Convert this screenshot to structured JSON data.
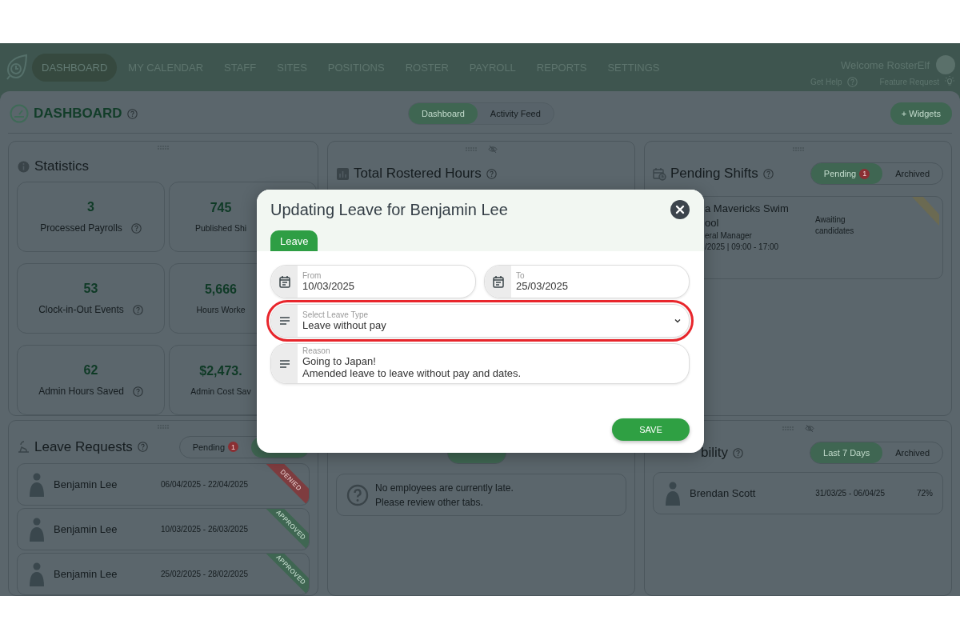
{
  "nav": {
    "items": [
      {
        "label": "DASHBOARD",
        "selected": true
      },
      {
        "label": "MY CALENDAR",
        "selected": false
      },
      {
        "label": "STAFF",
        "selected": false
      },
      {
        "label": "SITES",
        "selected": false
      },
      {
        "label": "POSITIONS",
        "selected": false
      },
      {
        "label": "ROSTER",
        "selected": false
      },
      {
        "label": "PAYROLL",
        "selected": false
      },
      {
        "label": "REPORTS",
        "selected": false
      },
      {
        "label": "SETTINGS",
        "selected": false
      }
    ],
    "welcome": "Welcome RosterElf",
    "help": "Get Help",
    "feature": "Feature Request"
  },
  "header": {
    "title": "DASHBOARD",
    "views": [
      {
        "label": "Dashboard",
        "selected": true
      },
      {
        "label": "Activity Feed",
        "selected": false
      }
    ],
    "add_button": "+ Widgets"
  },
  "statistics": {
    "title": "Statistics",
    "items": [
      {
        "value": "3",
        "label": "Processed Payrolls"
      },
      {
        "value": "745",
        "label": "Published Shi"
      },
      {
        "value": "53",
        "label": "Clock-in-Out Events"
      },
      {
        "value": "5,666",
        "label": "Hours Worke"
      },
      {
        "value": "62",
        "label": "Admin Hours Saved"
      },
      {
        "value": "$2,473.",
        "label": "Admin Cost Sav"
      }
    ]
  },
  "rostered_hours": {
    "title": "Total Rostered Hours"
  },
  "pending_shifts": {
    "title": "Pending Shifts",
    "tabs": [
      {
        "label": "Pending",
        "badge": "1",
        "selected": true
      },
      {
        "label": "Archived",
        "selected": false
      }
    ],
    "shift": {
      "lines": [
        "a Mavericks Swim",
        "ool",
        "eral Manager",
        "/2025 | 09:00 - 17:00"
      ],
      "status": "Awaiting candidates"
    }
  },
  "leave_requests": {
    "title": "Leave Requests",
    "tabs": [
      {
        "label": "Pending",
        "badge": "1",
        "selected": false
      },
      {
        "selected": true
      }
    ],
    "rows": [
      {
        "name": "Benjamin Lee",
        "dates": "06/04/2025 - 22/04/2025",
        "status": "DENIED",
        "kind": "denied"
      },
      {
        "name": "Benjamin Lee",
        "dates": "10/03/2025 - 26/03/2025",
        "status": "APPROVED",
        "kind": "approved"
      },
      {
        "name": "Benjamin Lee",
        "dates": "25/02/2025 - 28/02/2025",
        "status": "APPROVED",
        "kind": "approved"
      }
    ]
  },
  "late": {
    "tabs": [
      {
        "selected": true
      }
    ],
    "message": [
      "No employees are currently late.",
      "Please review other tabs."
    ]
  },
  "availability": {
    "title": "bility",
    "tabs": [
      {
        "label": "Last 7 Days",
        "selected": true
      },
      {
        "label": "Archived",
        "selected": false
      }
    ],
    "rows": [
      {
        "name": "Brendan Scott",
        "dates": "31/03/25 - 06/04/25",
        "percent": "72%"
      }
    ]
  },
  "modal": {
    "title": "Updating Leave for Benjamin Lee",
    "tabs": [
      {
        "label": "Leave",
        "selected": true
      }
    ],
    "fields": [
      {
        "kind": "date",
        "label": "From",
        "value": "10/03/2025",
        "highlighted": false
      },
      {
        "kind": "date",
        "label": "To",
        "value": "25/03/2025",
        "highlighted": false
      },
      {
        "kind": "select",
        "label": "Select Leave Type",
        "value": "Leave without pay",
        "highlighted": true
      },
      {
        "kind": "text",
        "label": "Reason",
        "value": "Going to Japan!\nAmended leave to leave without pay and dates.",
        "highlighted": false
      }
    ],
    "save": "SAVE"
  }
}
